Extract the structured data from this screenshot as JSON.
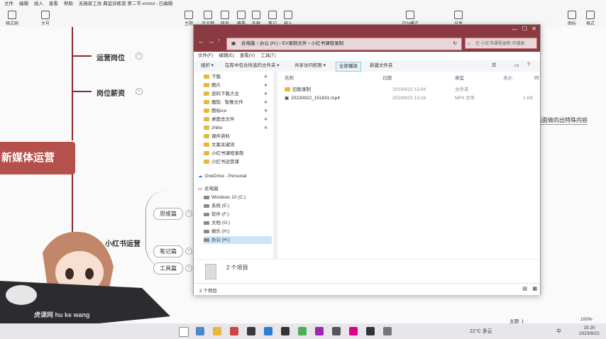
{
  "app": {
    "menu": [
      "文件",
      "编辑",
      "插入",
      "查看",
      "帮助"
    ],
    "doc_title": "无锡家工坊 典型训练营 第二节.xmind - 已编辑",
    "toolbar_left": [
      "格式刷",
      "大号"
    ],
    "toolbar_center": [
      "主题",
      "子主题",
      "联系",
      "概要",
      "外框",
      "笔记",
      "插入"
    ],
    "toolbar_right": [
      "ZEN模式",
      "分享",
      "图标",
      "格式"
    ]
  },
  "mindmap": {
    "root": "新媒体运营",
    "branches": [
      "运营岗位",
      "岗位薪资",
      "小红书运营"
    ],
    "subnodes": [
      "思维篇",
      "笔记篇",
      "工具篇"
    ],
    "right_note": "画面做的出特殊内容"
  },
  "explorer": {
    "breadcrumb": [
      "此电脑",
      "办公 (H:)",
      "EV录制文件",
      "小红书课程录制"
    ],
    "search_placeholder": "在 小红书课程录制 中搜索",
    "menu": [
      "文件(F)",
      "编辑(E)",
      "查看(V)",
      "工具(T)"
    ],
    "commands": [
      "组织 ▾",
      "在库中包含所选的文件夹 ▾",
      "共享访问权限 ▾",
      "全部播放",
      "新建文件夹"
    ],
    "nav": [
      {
        "label": "下载",
        "pin": true
      },
      {
        "label": "图片",
        "pin": true
      },
      {
        "label": "逐码下载大全",
        "pin": true
      },
      {
        "label": "魔陷 · 智推文件",
        "pin": true
      },
      {
        "label": "图标ico",
        "pin": true
      },
      {
        "label": "桌面总文件",
        "pin": true
      },
      {
        "label": "zhibo",
        "pin": true
      },
      {
        "label": "课件资料",
        "pin": false
      },
      {
        "label": "文案关键词",
        "pin": false
      },
      {
        "label": "小红书课程录制",
        "pin": false
      },
      {
        "label": "小红书运营课",
        "pin": false
      }
    ],
    "onedrive": "OneDrive - Personal",
    "thispc": "此电脑",
    "drives": [
      "Windows 10 (C:)",
      "系统 (E:)",
      "软件 (F:)",
      "文档 (G:)",
      "娱乐 (H:)",
      "办公 (H:)"
    ],
    "columns": [
      "名称",
      "日期",
      "类型",
      "大小",
      "时"
    ],
    "files": [
      {
        "name": "旧版录制",
        "date": "2023/9/22 15:04",
        "type": "文件夹",
        "size": ""
      },
      {
        "name": "20230922_151831.mp4",
        "date": "2023/9/22 15:18",
        "type": "MP4 文件",
        "size": "1 KB"
      }
    ],
    "preview_count": "2 个项目",
    "status": "2 个项目"
  },
  "statusbar_right": {
    "theme": "主题: 1",
    "zoom": "100%"
  },
  "taskbar": {
    "weather": "21°C 多云",
    "ime": "中",
    "time": "15:20",
    "date": "2023/9/22"
  },
  "watermark": "虎课网 hu ke wang"
}
